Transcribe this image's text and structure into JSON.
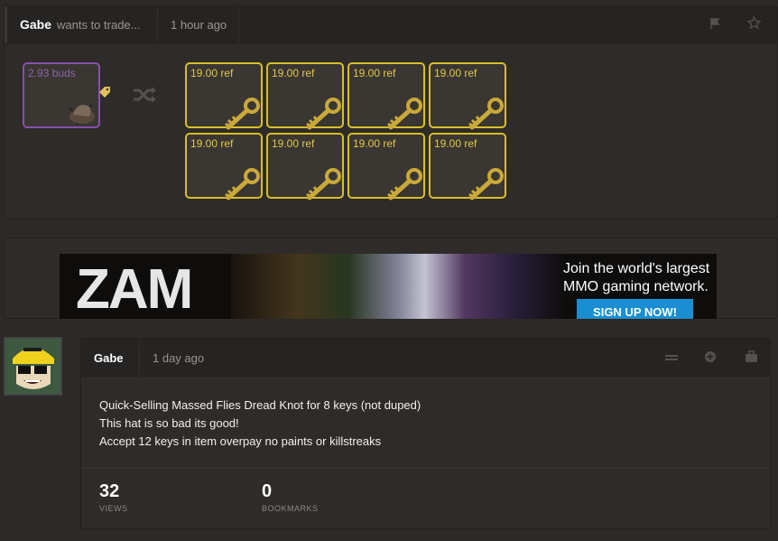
{
  "trade": {
    "user": "Gabe",
    "wants": "wants to trade...",
    "time": "1 hour ago",
    "offer": {
      "price": "2.93 buds"
    },
    "swap_icon": "shuffle-icon",
    "items": [
      {
        "price": "19.00 ref"
      },
      {
        "price": "19.00 ref"
      },
      {
        "price": "19.00 ref"
      },
      {
        "price": "19.00 ref"
      },
      {
        "price": "19.00 ref"
      },
      {
        "price": "19.00 ref"
      },
      {
        "price": "19.00 ref"
      },
      {
        "price": "19.00 ref"
      }
    ]
  },
  "ad": {
    "logo": "ZAM",
    "tagline_1": "Join the world's largest",
    "tagline_2": "MMO gaming network.",
    "cta": "SIGN UP NOW!"
  },
  "post": {
    "user": "Gabe",
    "time": "1 day ago",
    "lines": [
      "Quick-Selling Massed Flies Dread Knot for 8 keys (not duped)",
      "This hat is so bad its good!",
      "Accept 12 keys in item overpay no paints or killstreaks"
    ],
    "stats": {
      "views": "32",
      "views_label": "VIEWS",
      "bookmarks": "0",
      "bookmarks_label": "BOOKMARKS"
    }
  },
  "colors": {
    "key_border": "#d8bf2a",
    "unusual_border": "#8650ac",
    "cta": "#1a8ed0"
  }
}
